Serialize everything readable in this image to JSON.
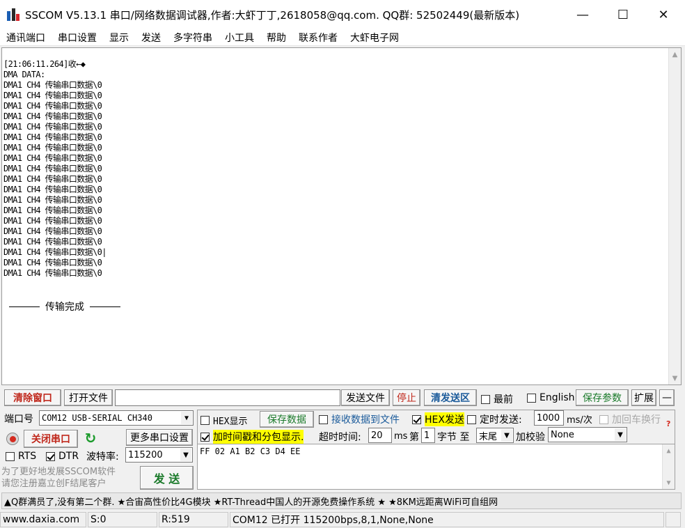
{
  "window": {
    "title": "SSCOM V5.13.1 串口/网络数据调试器,作者:大虾丁丁,2618058@qq.com. QQ群: 52502449(最新版本)",
    "icon": "sscom-app-icon",
    "controls": {
      "minimize": "—",
      "maximize": "☐",
      "close": "✕"
    }
  },
  "menu": [
    "通讯端口",
    "串口设置",
    "显示",
    "发送",
    "多字符串",
    "小工具",
    "帮助",
    "联系作者",
    "大虾电子网"
  ],
  "receive": {
    "timestamp_line": "[21:06:11.264]收←◆",
    "header_line": "DMA DATA:",
    "lines": [
      "DMA1 CH4 传输串口数据\\0",
      "DMA1 CH4 传输串口数据\\0",
      "DMA1 CH4 传输串口数据\\0",
      "DMA1 CH4 传输串口数据\\0",
      "DMA1 CH4 传输串口数据\\0",
      "DMA1 CH4 传输串口数据\\0",
      "DMA1 CH4 传输串口数据\\0",
      "DMA1 CH4 传输串口数据\\0",
      "DMA1 CH4 传输串口数据\\0",
      "DMA1 CH4 传输串口数据\\0",
      "DMA1 CH4 传输串口数据\\0",
      "DMA1 CH4 传输串口数据\\0",
      "DMA1 CH4 传输串口数据\\0",
      "DMA1 CH4 传输串口数据\\0",
      "DMA1 CH4 传输串口数据\\0",
      "DMA1 CH4 传输串口数据\\0",
      "DMA1 CH4 传输串口数据\\0|",
      "DMA1 CH4 传输串口数据\\0",
      "DMA1 CH4 传输串口数据\\0"
    ],
    "footer": "传输完成"
  },
  "toolbar": {
    "clear_window": "清除窗口",
    "open_file": "打开文件",
    "file_path": "",
    "send_file": "发送文件",
    "stop": "停止",
    "clear_send": "清发送区",
    "topmost": "最前",
    "english": "English",
    "save_params": "保存参数",
    "expand": "扩展",
    "collapse": "—"
  },
  "port": {
    "label": "端口号",
    "value": "COM12 USB-SERIAL CH340",
    "close_port": "关闭串口",
    "more_settings": "更多串口设置",
    "rts": "RTS",
    "dtr": "DTR",
    "baud_label": "波特率:",
    "baud_value": "115200",
    "promo": [
      "为了更好地发展SSCOM软件",
      "请您注册嘉立创F结尾客户"
    ],
    "send_button": "发 送"
  },
  "options": {
    "hex_display": "HEX显示",
    "save_data": "保存数据",
    "recv_to_file": "接收数据到文件",
    "hex_send": "HEX发送",
    "timed_send": "定时发送:",
    "interval_value": "1000",
    "interval_unit": "ms/次",
    "append_crlf": "加回车换行",
    "timestamp_packet": "加时间戳和分包显示.",
    "timeout_label": "超时时间:",
    "timeout_value": "20",
    "timeout_unit": "ms",
    "nth_label": "第",
    "nth_value": "1",
    "byte_label": "字节 至",
    "end_value": "末尾",
    "checksum_label": "加校验",
    "checksum_value": "None",
    "help_mark": "?"
  },
  "send": {
    "content": "FF 02 A1 B2 C3 D4 EE"
  },
  "marquee": "▲Q群满员了,没有第二个群. ★合宙高性价比4G模块 ★RT-Thread中国人的开源免费操作系统 ★ ★8KM远距离WiFi可自组网",
  "status": {
    "website": "www.daxia.com",
    "sent": "S:0",
    "received": "R:519",
    "port_info": "COM12 已打开  115200bps,8,1,None,None"
  }
}
